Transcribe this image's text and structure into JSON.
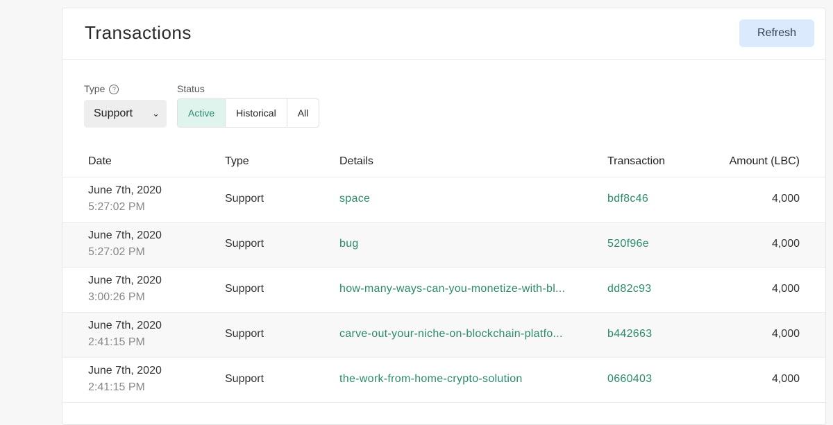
{
  "header": {
    "title": "Transactions",
    "refresh_label": "Refresh"
  },
  "filters": {
    "type_label": "Type",
    "type_help_icon": "?",
    "type_value": "Support",
    "status_label": "Status",
    "status_options": [
      "Active",
      "Historical",
      "All"
    ],
    "status_selected": "Active"
  },
  "columns": [
    "Date",
    "Type",
    "Details",
    "Transaction",
    "Amount (LBC)"
  ],
  "rows": [
    {
      "date": "June 7th, 2020",
      "time": "5:27:02 PM",
      "type": "Support",
      "details": "space",
      "txid": "bdf8c46",
      "amount": "4,000"
    },
    {
      "date": "June 7th, 2020",
      "time": "5:27:02 PM",
      "type": "Support",
      "details": "bug",
      "txid": "520f96e",
      "amount": "4,000"
    },
    {
      "date": "June 7th, 2020",
      "time": "3:00:26 PM",
      "type": "Support",
      "details": "how-many-ways-can-you-monetize-with-bl...",
      "txid": "dd82c93",
      "amount": "4,000"
    },
    {
      "date": "June 7th, 2020",
      "time": "2:41:15 PM",
      "type": "Support",
      "details": "carve-out-your-niche-on-blockchain-platfo...",
      "txid": "b442663",
      "amount": "4,000"
    },
    {
      "date": "June 7th, 2020",
      "time": "2:41:15 PM",
      "type": "Support",
      "details": "the-work-from-home-crypto-solution",
      "txid": "0660403",
      "amount": "4,000"
    }
  ]
}
